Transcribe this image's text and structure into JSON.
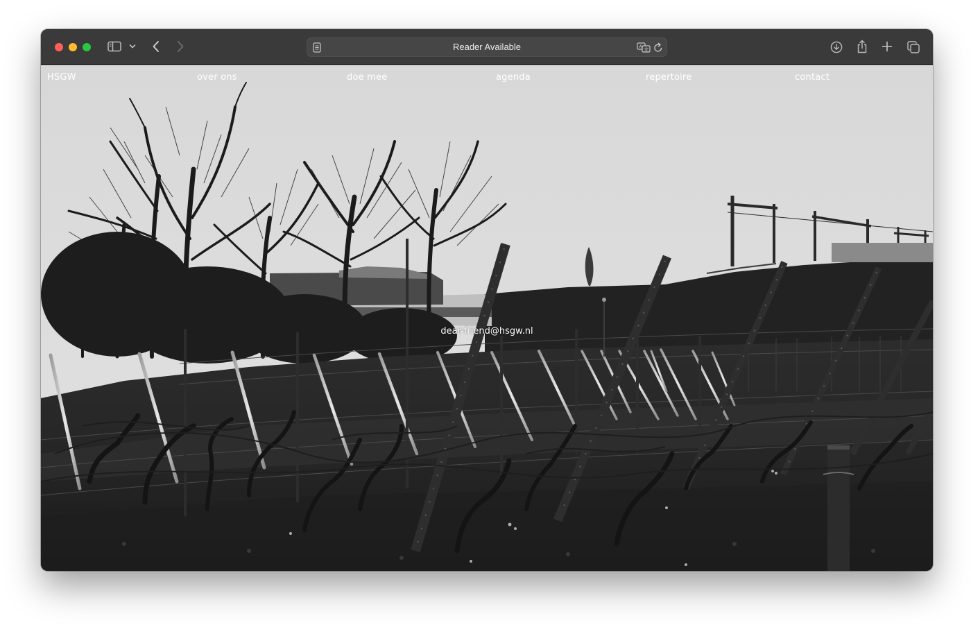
{
  "browser": {
    "address_text": "Reader Available",
    "icons": {
      "sidebar": "sidebar-icon",
      "sidebar_menu": "chevron-down-icon",
      "back": "chevron-left-icon",
      "forward": "chevron-right-icon",
      "reader": "reader-page-icon",
      "translate": "translate-icon",
      "reload": "reload-icon",
      "downloads": "download-icon",
      "share": "share-icon",
      "new_tab": "plus-icon",
      "tabs": "tab-overview-icon"
    },
    "colors": {
      "close": "#ff5f57",
      "minimize": "#febc2e",
      "zoom": "#28c840",
      "toolbar": "#3a3a3a"
    }
  },
  "site": {
    "nav": [
      {
        "label": "HSGW"
      },
      {
        "label": "over ons"
      },
      {
        "label": "doe mee"
      },
      {
        "label": "agenda"
      },
      {
        "label": "repertoire"
      },
      {
        "label": "contact"
      }
    ],
    "email": "dear-friend@hsgw.nl",
    "hero_image": "black-and-white-vineyard-photo",
    "colors": {
      "nav_text": "#ffffff",
      "sky": "#d9d9d9"
    }
  }
}
